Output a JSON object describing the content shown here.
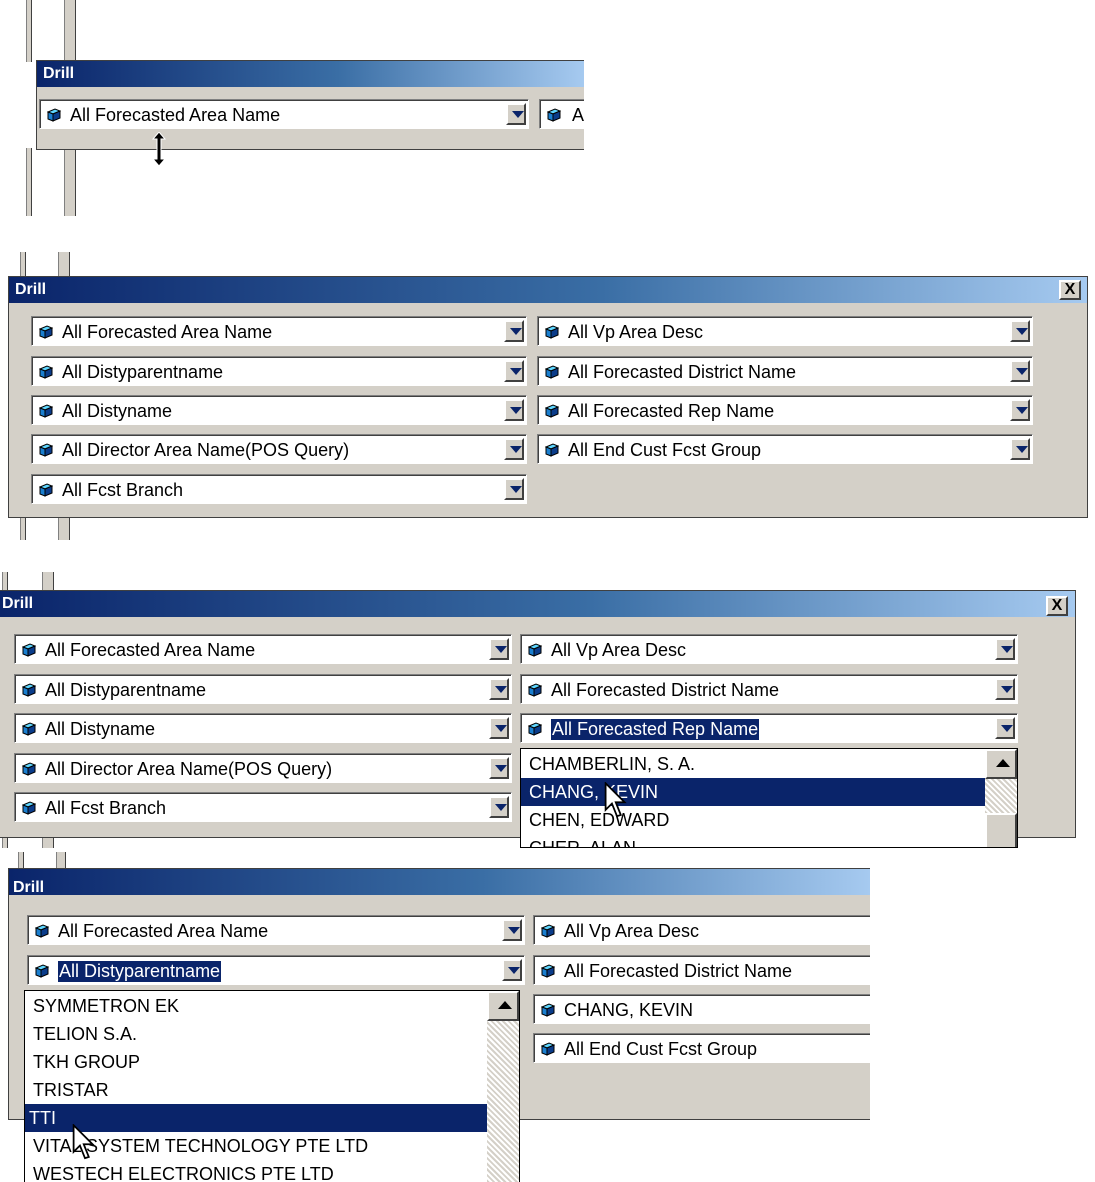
{
  "dialog_title": "Drill",
  "close_label": "X",
  "icon": "cube-icon",
  "panel1": {
    "combo_left_1": "All Forecasted Area Name",
    "combo_right_partial": "A"
  },
  "panel2": {
    "left": [
      "All Forecasted Area Name",
      "All Distyparentname",
      "All Distyname",
      "All Director Area Name(POS Query)",
      "All Fcst Branch"
    ],
    "right": [
      "All Vp Area Desc",
      "All Forecasted District Name",
      "All Forecasted Rep Name",
      "All End Cust Fcst Group"
    ]
  },
  "panel3": {
    "left": [
      "All Forecasted Area Name",
      "All Distyparentname",
      "All Distyname",
      "All Director Area Name(POS Query)",
      "All Fcst Branch"
    ],
    "right": [
      "All Vp Area Desc",
      "All Forecasted District Name",
      "All Forecasted Rep Name"
    ],
    "dropdown": [
      "CHAMBERLIN, S. A.",
      "CHANG, KEVIN",
      "CHEN, EDWARD",
      "CHER, ALAN"
    ],
    "dropdown_selected": "CHANG, KEVIN"
  },
  "panel4": {
    "left": [
      "All Forecasted Area Name",
      "All Distyparentname"
    ],
    "right": [
      "All Vp Area Desc",
      "All Forecasted District Name",
      "CHANG, KEVIN",
      "All End Cust Fcst Group"
    ],
    "dropdown": [
      "SYMMETRON EK",
      "TELION S.A.",
      "TKH GROUP",
      "TRISTAR",
      "TTI",
      "VITAL SYSTEM TECHNOLOGY PTE LTD",
      "WESTECH ELECTRONICS PTE LTD"
    ],
    "dropdown_selected": "TTI"
  }
}
